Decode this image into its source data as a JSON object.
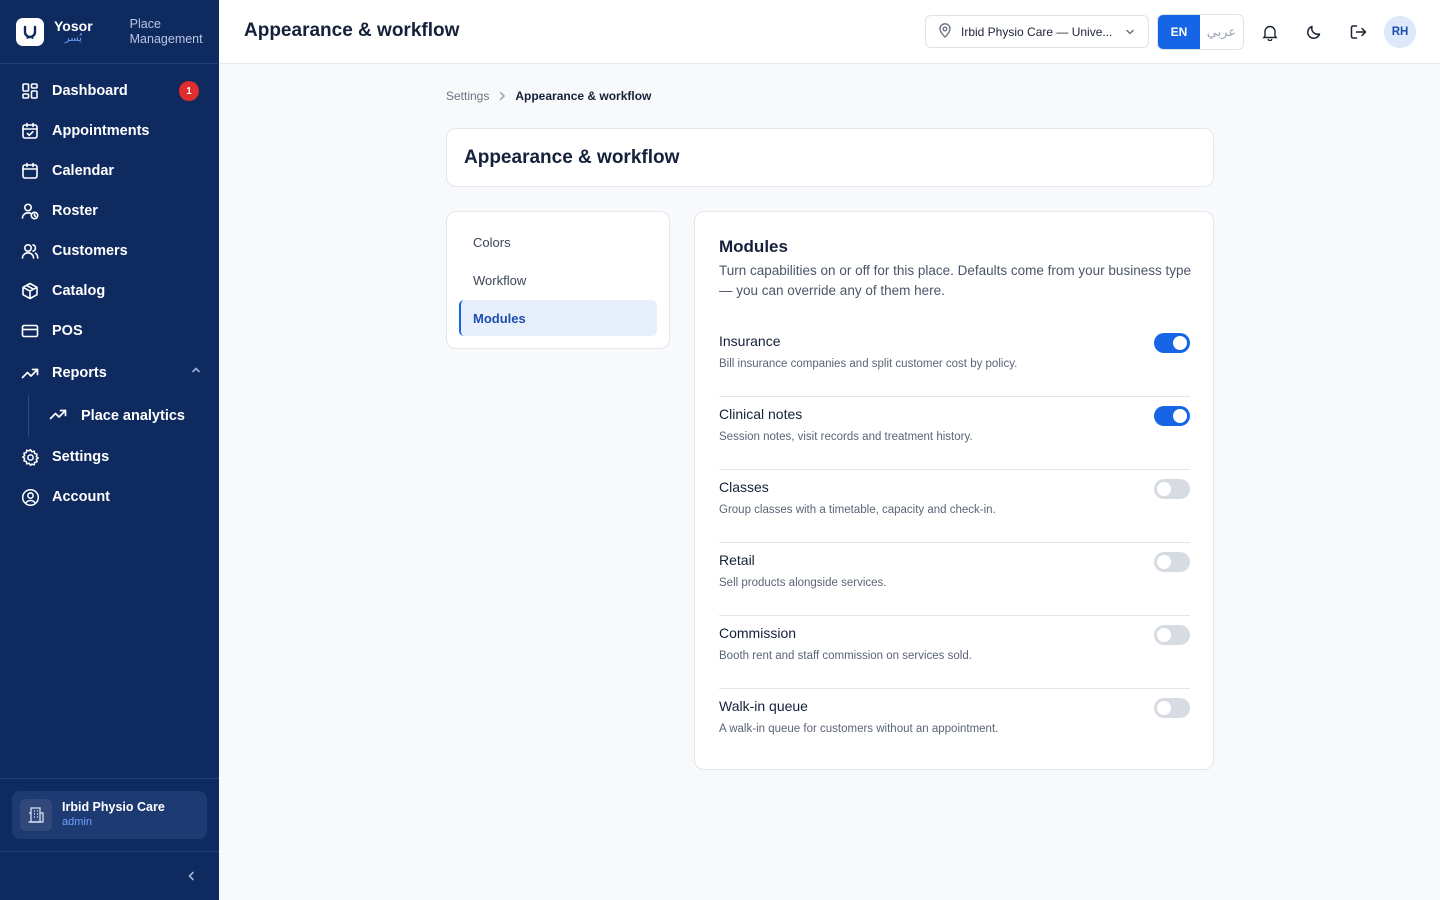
{
  "brand": {
    "name": "Yosor",
    "name_ar": "يُسر",
    "subtitle_line1": "Place",
    "subtitle_line2": "Management"
  },
  "sidebar": {
    "items": [
      {
        "label": "Dashboard",
        "icon": "dashboard-icon",
        "badge": "1"
      },
      {
        "label": "Appointments",
        "icon": "calendar-check-icon"
      },
      {
        "label": "Calendar",
        "icon": "calendar-icon"
      },
      {
        "label": "Roster",
        "icon": "user-clock-icon"
      },
      {
        "label": "Customers",
        "icon": "users-icon"
      },
      {
        "label": "Catalog",
        "icon": "box-icon"
      },
      {
        "label": "POS",
        "icon": "credit-card-icon"
      },
      {
        "label": "Reports",
        "icon": "trend-icon",
        "expanded": true
      },
      {
        "label": "Place analytics",
        "icon": "trend-icon"
      },
      {
        "label": "Settings",
        "icon": "gear-icon"
      },
      {
        "label": "Account",
        "icon": "user-circle-icon"
      }
    ],
    "place": {
      "name": "Irbid Physio Care",
      "role": "admin"
    }
  },
  "header": {
    "title": "Appearance & workflow",
    "place_select": "Irbid Physio Care — Unive...",
    "lang_en": "EN",
    "lang_ar": "عربي",
    "avatar": "RH"
  },
  "breadcrumb": {
    "parent": "Settings",
    "current": "Appearance & workflow"
  },
  "page": {
    "title": "Appearance & workflow",
    "tabs": [
      {
        "label": "Colors",
        "active": false
      },
      {
        "label": "Workflow",
        "active": false
      },
      {
        "label": "Modules",
        "active": true
      }
    ]
  },
  "modules": {
    "title": "Modules",
    "description": "Turn capabilities on or off for this place. Defaults come from your business type — you can override any of them here.",
    "items": [
      {
        "name": "Insurance",
        "description": "Bill insurance companies and split customer cost by policy.",
        "enabled": true
      },
      {
        "name": "Clinical notes",
        "description": "Session notes, visit records and treatment history.",
        "enabled": true
      },
      {
        "name": "Classes",
        "description": "Group classes with a timetable, capacity and check-in.",
        "enabled": false
      },
      {
        "name": "Retail",
        "description": "Sell products alongside services.",
        "enabled": false
      },
      {
        "name": "Commission",
        "description": "Booth rent and staff commission on services sold.",
        "enabled": false
      },
      {
        "name": "Walk-in queue",
        "description": "A walk-in queue for customers without an appointment.",
        "enabled": false
      }
    ]
  },
  "colors": {
    "sidebar": "#0f2a5f",
    "accent": "#1565e6",
    "badge": "#e02d2d"
  }
}
